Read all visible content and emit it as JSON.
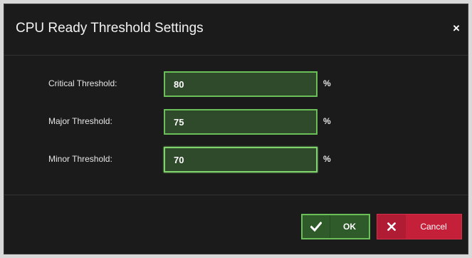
{
  "dialog": {
    "title": "CPU Ready Threshold Settings",
    "close_icon": "close-icon",
    "close_glyph": "×"
  },
  "fields": [
    {
      "label": "Critical Threshold:",
      "value": "80",
      "unit": "%"
    },
    {
      "label": "Major Threshold:",
      "value": "75",
      "unit": "%"
    },
    {
      "label": "Minor Threshold:",
      "value": "70",
      "unit": "%",
      "focused": true
    }
  ],
  "buttons": {
    "ok": {
      "label": "OK",
      "icon": "checkmark-icon"
    },
    "cancel": {
      "label": "Cancel",
      "icon": "x-icon"
    }
  },
  "colors": {
    "dialog_background": "#1b1b1b",
    "input_background": "#2f4a2b",
    "input_border": "#6bbf59",
    "ok_background": "#2f5a29",
    "cancel_background": "#c4203a"
  }
}
